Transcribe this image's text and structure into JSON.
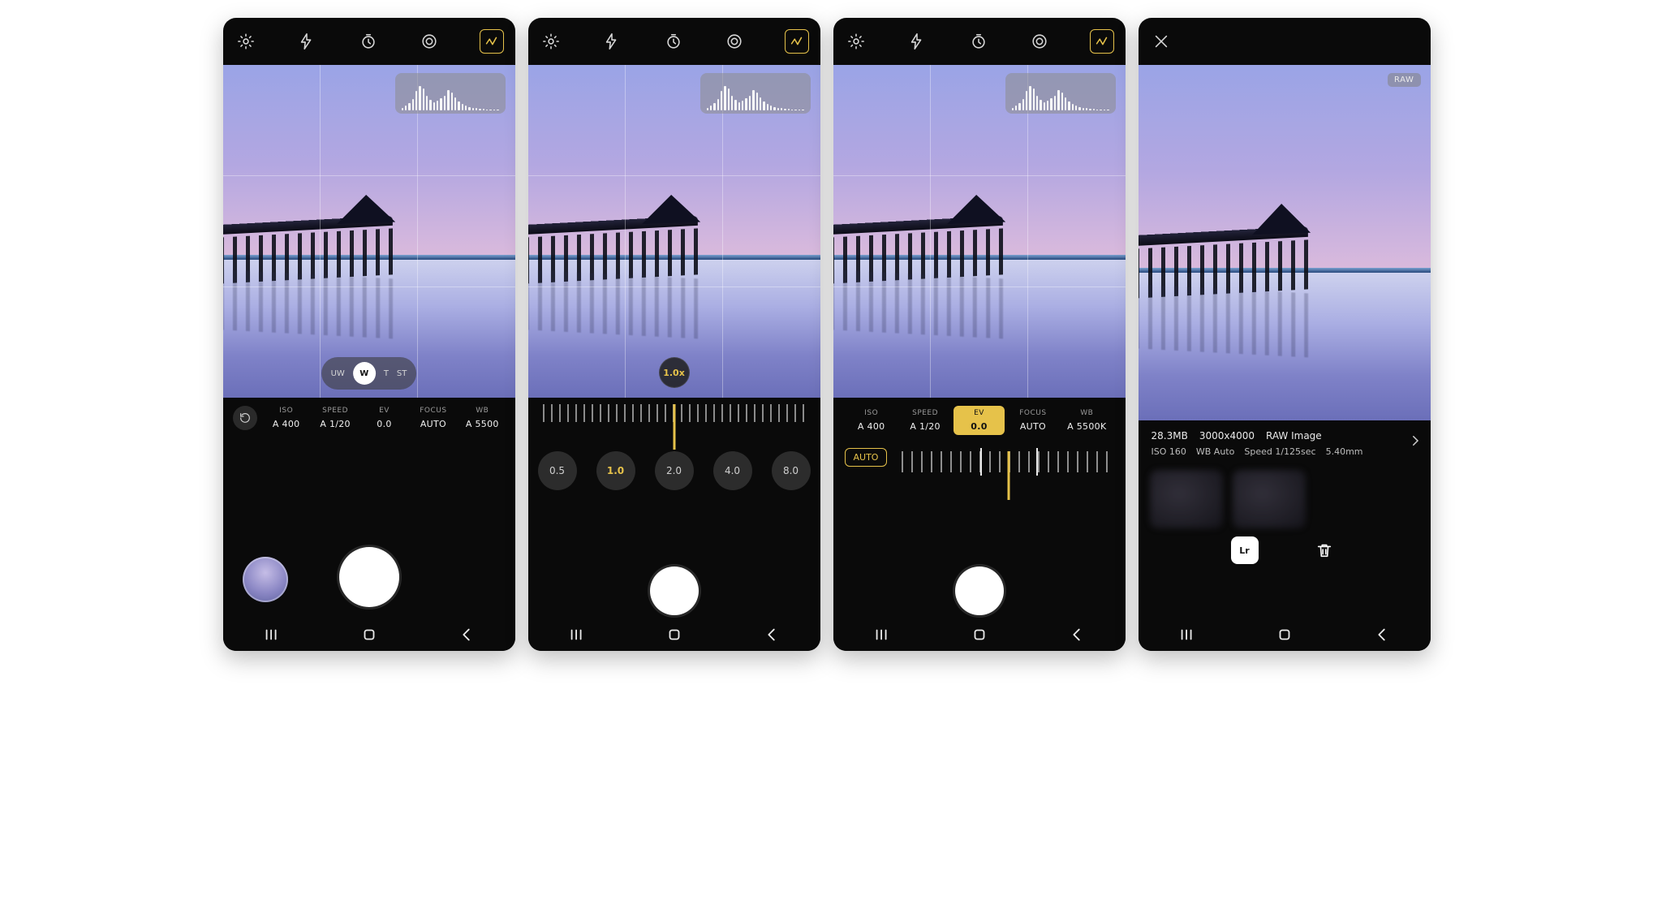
{
  "accent": "#e6c24a",
  "topbar_icons": [
    "settings-gear",
    "flash",
    "timer",
    "metering",
    "histogram-toggle"
  ],
  "histogram_heights": [
    8,
    14,
    22,
    34,
    58,
    72,
    64,
    44,
    30,
    24,
    28,
    36,
    44,
    60,
    52,
    38,
    26,
    18,
    14,
    10,
    8,
    6,
    5,
    4,
    3,
    3,
    2,
    2
  ],
  "s1": {
    "lens": {
      "options": [
        "UW",
        "W",
        "T",
        "ST"
      ],
      "selected": "W"
    },
    "settings": {
      "round_icon": "reset-icon",
      "cols": [
        {
          "k": "ISO",
          "v": "A 400"
        },
        {
          "k": "SPEED",
          "v": "A 1/20"
        },
        {
          "k": "EV",
          "v": "0.0"
        },
        {
          "k": "FOCUS",
          "v": "AUTO"
        },
        {
          "k": "WB",
          "v": "A 5500"
        }
      ]
    }
  },
  "s2": {
    "zoom_bubble": "1.0x",
    "zoom_values": [
      "0.5",
      "1.0",
      "2.0",
      "4.0",
      "8.0"
    ],
    "zoom_selected": "1.0"
  },
  "s3": {
    "settings": {
      "cols": [
        {
          "k": "ISO",
          "v": "A 400"
        },
        {
          "k": "SPEED",
          "v": "A 1/20"
        },
        {
          "k": "EV",
          "v": "0.0",
          "active": true
        },
        {
          "k": "FOCUS",
          "v": "AUTO"
        },
        {
          "k": "WB",
          "v": "A 5500K"
        }
      ]
    },
    "auto_label": "AUTO"
  },
  "s4": {
    "raw_chip": "RAW",
    "info": {
      "size": "28.3MB",
      "dims": "3000x4000",
      "type": "RAW Image",
      "iso": "ISO 160",
      "wb": "WB Auto",
      "speed": "Speed 1/125sec",
      "focal": "5.40mm"
    },
    "lr_label": "Lr"
  },
  "nav_labels": {
    "recents": "recents",
    "home": "home",
    "back": "back"
  }
}
